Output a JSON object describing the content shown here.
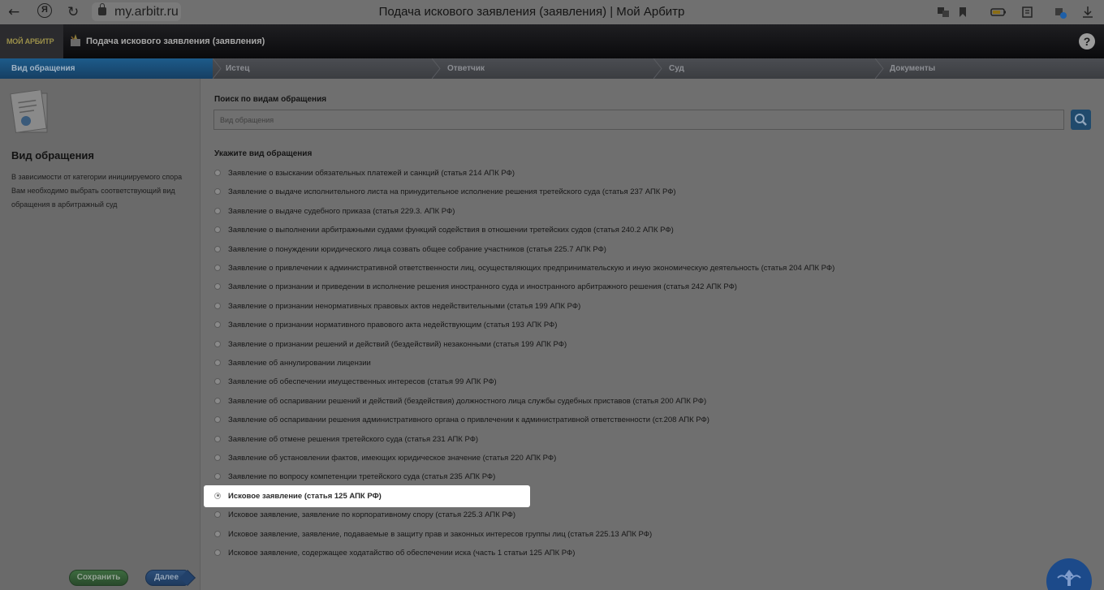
{
  "browser": {
    "url": "my.arbitr.ru",
    "window_title": "Подача искового заявления (заявления) | Мой Арбитр",
    "icons": [
      "back-arrow-icon",
      "yandex-icon",
      "reload-icon",
      "lock-icon",
      "translate-icon",
      "bookmark-icon",
      "battery-icon",
      "extensions-icon",
      "profile-icon",
      "download-icon"
    ]
  },
  "app": {
    "logo": "МОЙ АРБИТР",
    "title": "Подача искового заявления (заявления)",
    "help": "?"
  },
  "steps": [
    {
      "label": "Вид обращения",
      "active": true
    },
    {
      "label": "Истец",
      "active": false
    },
    {
      "label": "Ответчик",
      "active": false
    },
    {
      "label": "Суд",
      "active": false
    },
    {
      "label": "Документы",
      "active": false
    }
  ],
  "sidebar": {
    "title": "Вид обращения",
    "description": "В зависимости от категории инициируемого спора Вам необходимо выбрать соответствующий вид обращения в арбитражный суд",
    "save_button": "Сохранить",
    "next_button": "Далее"
  },
  "main": {
    "search_label": "Поиск по видам обращения",
    "search_placeholder": "Вид обращения",
    "types_label": "Укажите вид обращения",
    "selected_index": 17,
    "options": [
      "Заявление о взыскании обязательных платежей и санкций (статья 214 АПК РФ)",
      "Заявление о выдаче исполнительного листа на принудительное исполнение решения третейского суда (статья 237 АПК РФ)",
      "Заявление о выдаче судебного приказа (статья 229.3. АПК РФ)",
      "Заявление о выполнении арбитражными судами функций содействия в отношении третейских судов (статья 240.2 АПК РФ)",
      "Заявление о понуждении юридического лица созвать общее собрание участников (статья 225.7 АПК РФ)",
      "Заявление о привлечении к административной ответственности лиц, осуществляющих предпринимательскую и иную экономическую деятельность (статья 204 АПК РФ)",
      "Заявление о признании и приведении в исполнение решения иностранного суда и иностранного арбитражного решения (статья 242 АПК РФ)",
      "Заявление о признании ненормативных правовых актов недействительными (статья 199 АПК РФ)",
      "Заявление о признании нормативного правового акта недействующим (статья 193 АПК РФ)",
      "Заявление о признании решений и действий (бездействий) незаконными (статья 199 АПК РФ)",
      "Заявление об аннулировании лицензии",
      "Заявление об обеспечении имущественных интересов (статья 99 АПК РФ)",
      "Заявление об оспаривании решений и действий (бездействия) должностного лица службы судебных приставов (статья 200 АПК РФ)",
      "Заявление об оспаривании решения административного органа о привлечении к административной ответственности (ст.208 АПК РФ)",
      "Заявление об отмене решения третейского суда (статья 231 АПК РФ)",
      "Заявление об установлении фактов, имеющих юридическое значение (статья 220 АПК РФ)",
      "Заявление по вопросу компетенции третейского суда (статья 235 АПК РФ)",
      "Исковое заявление (статья 125 АПК РФ)",
      "Исковое заявление, заявление по корпоративному спору (статья 225.3 АПК РФ)",
      "Исковое заявление, заявление, подаваемые в защиту прав и законных интересов группы лиц (статья 225.13 АПК РФ)",
      "Исковое заявление, содержащее ходатайство об обеспечении иска (часть 1 статьи 125 АПК РФ)"
    ]
  }
}
